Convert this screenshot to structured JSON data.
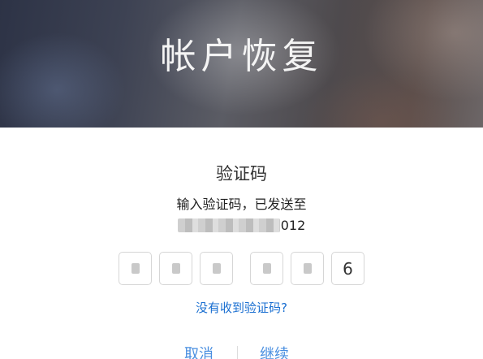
{
  "header": {
    "title": "帐户恢复"
  },
  "verification": {
    "heading": "验证码",
    "instruction": "输入验证码，已发送至",
    "destination_suffix": "012",
    "code_digits": [
      "",
      "",
      "",
      "",
      "",
      "6"
    ],
    "help_link": "没有收到验证码?"
  },
  "actions": {
    "cancel_label": "取消",
    "continue_label": "继续"
  },
  "colors": {
    "link": "#1a6fd1",
    "action": "#4a8fe0",
    "text": "#333333"
  }
}
